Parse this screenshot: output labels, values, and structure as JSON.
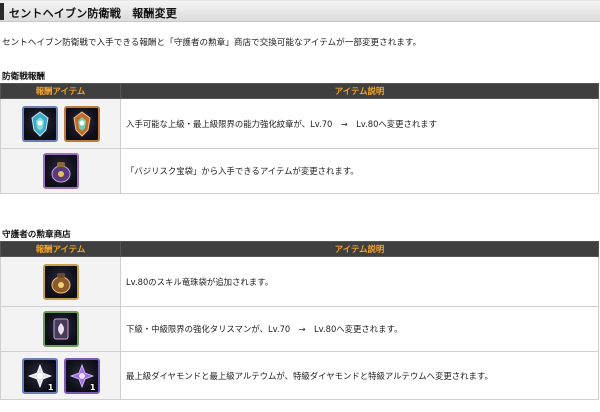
{
  "header": {
    "title": "セントヘイブン防衛戦　報酬変更"
  },
  "intro": "セントヘイブン防衛戦で入手できる報酬と「守護者の勲章」商店で交換可能なアイテムが一部変更されます。",
  "sections": [
    {
      "label": "防衛戦報酬",
      "columns": [
        "報酬アイテム",
        "アイテム説明"
      ],
      "rows": [
        {
          "icons": [
            "emblem-blue-icon",
            "emblem-orange-icon"
          ],
          "description": "入手可能な上級・最上級限界の能力強化紋章が、Lv.70　→　Lv.80へ変更されます"
        },
        {
          "icons": [
            "basilisk-treasure-bag-icon"
          ],
          "description": "「バジリスク宝袋」から入手できるアイテムが変更されます。"
        }
      ]
    },
    {
      "label": "守護者の勲章商店",
      "columns": [
        "報酬アイテム",
        "アイテム説明"
      ],
      "rows": [
        {
          "icons": [
            "skill-orb-pouch-icon"
          ],
          "description": "Lv.80のスキル竜珠袋が追加されます。"
        },
        {
          "icons": [
            "talisman-icon"
          ],
          "description": "下級・中級限界の強化タリスマンが、Lv.70　→　Lv.80へ変更されます。"
        },
        {
          "icons": [
            "diamond-icon",
            "alteum-icon"
          ],
          "quantities": [
            "1",
            "1"
          ],
          "description": "最上級ダイヤモンドと最上級アルテウムが、特級ダイヤモンドと特級アルテウムへ変更されます。"
        }
      ]
    }
  ]
}
